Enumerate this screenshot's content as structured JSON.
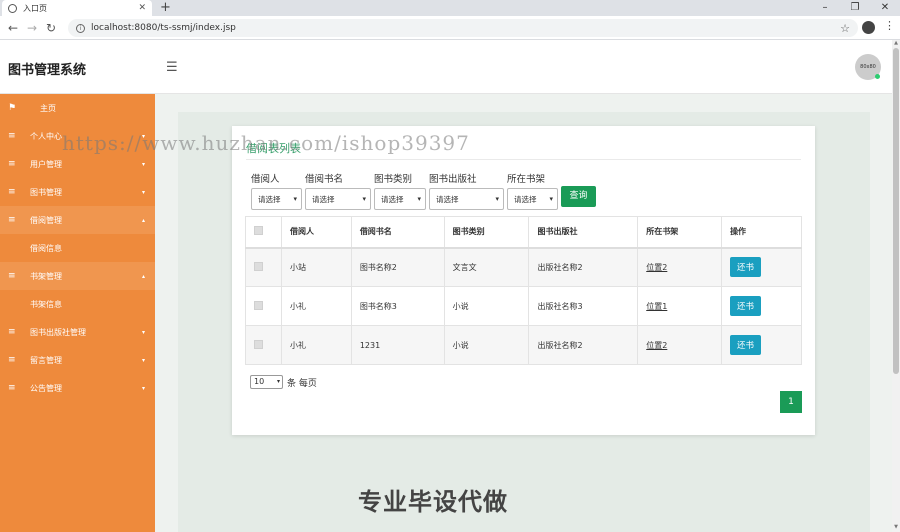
{
  "browser": {
    "tab_title": "入口页",
    "url": "localhost:8080/ts-ssmj/index.jsp",
    "win_minimize": "–",
    "win_restore": "❐",
    "win_close": "✕"
  },
  "header": {
    "app_title": "图书管理系统",
    "avatar_text": "80x80"
  },
  "sidebar": {
    "items": [
      {
        "label": "主页",
        "icon": "⚑",
        "caret": ""
      },
      {
        "label": "个人中心",
        "icon": "≡",
        "caret": "▾"
      },
      {
        "label": "用户管理",
        "icon": "≡",
        "caret": "▾"
      },
      {
        "label": "图书管理",
        "icon": "≡",
        "caret": "▾"
      },
      {
        "label": "借阅管理",
        "icon": "≡",
        "caret": "▴"
      },
      {
        "label": "借阅信息",
        "icon": "",
        "caret": ""
      },
      {
        "label": "书架管理",
        "icon": "≡",
        "caret": "▴"
      },
      {
        "label": "书架信息",
        "icon": "",
        "caret": ""
      },
      {
        "label": "图书出版社管理",
        "icon": "≡",
        "caret": "▾"
      },
      {
        "label": "留言管理",
        "icon": "≡",
        "caret": "▾"
      },
      {
        "label": "公告管理",
        "icon": "≡",
        "caret": "▾"
      }
    ]
  },
  "card": {
    "title": "借阅表列表",
    "filters": [
      {
        "label": "借阅人",
        "value": "请选择"
      },
      {
        "label": "借阅书名",
        "value": "请选择"
      },
      {
        "label": "图书类别",
        "value": "请选择"
      },
      {
        "label": "图书出版社",
        "value": "请选择"
      },
      {
        "label": "所在书架",
        "value": "请选择"
      }
    ],
    "query_label": "查询"
  },
  "table": {
    "headers": [
      "借阅人",
      "借阅书名",
      "图书类别",
      "图书出版社",
      "所在书架",
      "操作"
    ],
    "rows": [
      {
        "borrower": "小站",
        "book": "图书名称2",
        "category": "文言文",
        "publisher": "出版社名称2",
        "shelf": "位置2",
        "action": "还书"
      },
      {
        "borrower": "小礼",
        "book": "图书名称3",
        "category": "小说",
        "publisher": "出版社名称3",
        "shelf": "位置1",
        "action": "还书"
      },
      {
        "borrower": "小礼",
        "book": "1231",
        "category": "小说",
        "publisher": "出版社名称2",
        "shelf": "位置2",
        "action": "还书"
      }
    ]
  },
  "pagination": {
    "page_size": "10",
    "page_size_suffix": "条 每页",
    "current_page": "1"
  },
  "overlay": {
    "url_watermark": "https://www.huzhan.com/ishop39397",
    "text_watermark": "专业毕设代做"
  }
}
